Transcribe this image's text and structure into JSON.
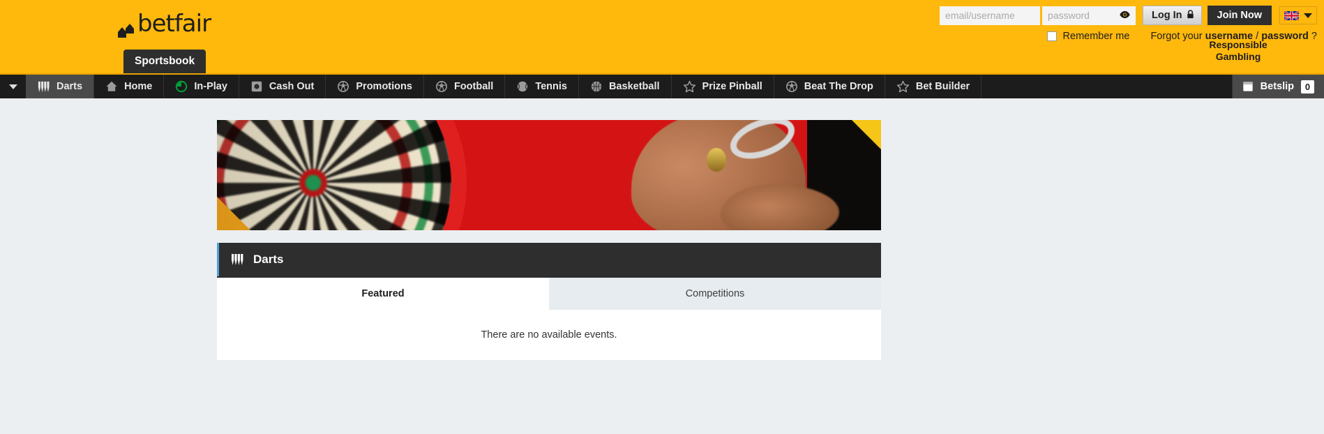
{
  "brand": {
    "name": "betfair",
    "logo_icon": "betfair-arrows-logo",
    "accent_yellow": "#ffb80c",
    "nav_dark": "#1c1c1c",
    "page_bg": "#eceff2"
  },
  "header": {
    "sportsbook_tab": "Sportsbook",
    "login": {
      "username_placeholder": "email/username",
      "username_value": "",
      "password_placeholder": "password",
      "password_value": "",
      "show_password_icon": "eye-icon",
      "login_label": "Log In",
      "login_icon": "lock-icon",
      "join_label": "Join Now",
      "remember_label": "Remember me",
      "remember_checked": false,
      "forgot_prefix": "Forgot your ",
      "forgot_username": "username",
      "forgot_separator": " / ",
      "forgot_password": "password",
      "forgot_suffix": " ?"
    },
    "language": {
      "flag_icon": "uk-flag-icon",
      "caret_icon": "chevron-down-icon"
    },
    "responsible_gambling": "Responsible\nGambling",
    "responsible_gambling_line1": "Responsible",
    "responsible_gambling_line2": "Gambling"
  },
  "nav": {
    "menu_caret_icon": "chevron-down-icon",
    "items": [
      {
        "label": "Darts",
        "icon": "darts-icon",
        "active": true
      },
      {
        "label": "Home",
        "icon": "home-icon",
        "active": false
      },
      {
        "label": "In-Play",
        "icon": "in-play-icon",
        "active": false
      },
      {
        "label": "Cash Out",
        "icon": "cash-out-icon",
        "active": false
      },
      {
        "label": "Promotions",
        "icon": "football-icon",
        "active": false
      },
      {
        "label": "Football",
        "icon": "football-icon",
        "active": false
      },
      {
        "label": "Tennis",
        "icon": "tennis-icon",
        "active": false
      },
      {
        "label": "Basketball",
        "icon": "basketball-icon",
        "active": false
      },
      {
        "label": "Prize Pinball",
        "icon": "star-icon",
        "active": false
      },
      {
        "label": "Beat The Drop",
        "icon": "football-icon",
        "active": false
      },
      {
        "label": "Bet Builder",
        "icon": "star-icon",
        "active": false
      }
    ],
    "betslip": {
      "label": "Betslip",
      "icon": "betslip-icon",
      "count": "0"
    }
  },
  "main": {
    "hero": {
      "alt": "darts-promo-banner"
    },
    "section": {
      "title": "Darts",
      "icon": "darts-icon"
    },
    "tabs": [
      {
        "label": "Featured",
        "active": true
      },
      {
        "label": "Competitions",
        "active": false
      }
    ],
    "empty_message": "There are no available events."
  }
}
